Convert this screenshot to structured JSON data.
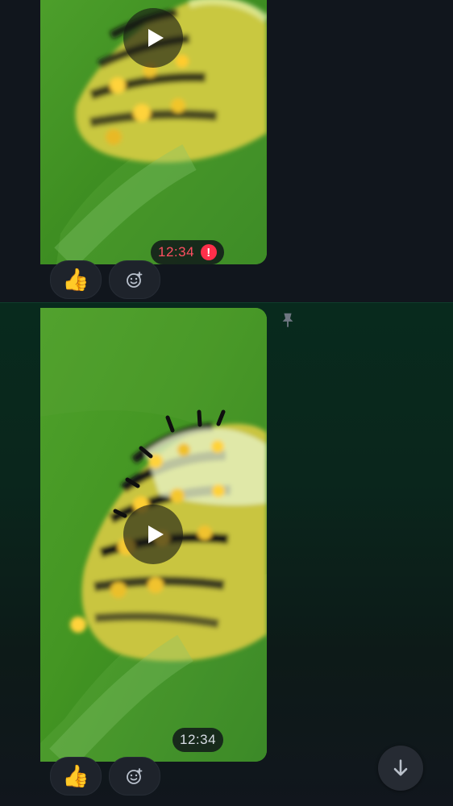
{
  "messages": [
    {
      "time": "12:34",
      "status": "error",
      "reactions": {
        "thumb": "👍"
      }
    },
    {
      "time": "12:34",
      "status": "sent",
      "pinned": true,
      "reactions": {
        "thumb": "👍"
      }
    }
  ],
  "icons": {
    "play": "play-icon",
    "error": "error-icon",
    "add_reaction": "add-reaction-icon",
    "pin": "pin-icon",
    "scroll_down": "arrow-down-icon"
  },
  "colors": {
    "background": "#12161d",
    "selected_row": "#082a1d",
    "error": "#ff2f4a",
    "time_error": "#ff4f61",
    "reaction_chip": "#1e232b",
    "scroll_button": "#262b33"
  }
}
